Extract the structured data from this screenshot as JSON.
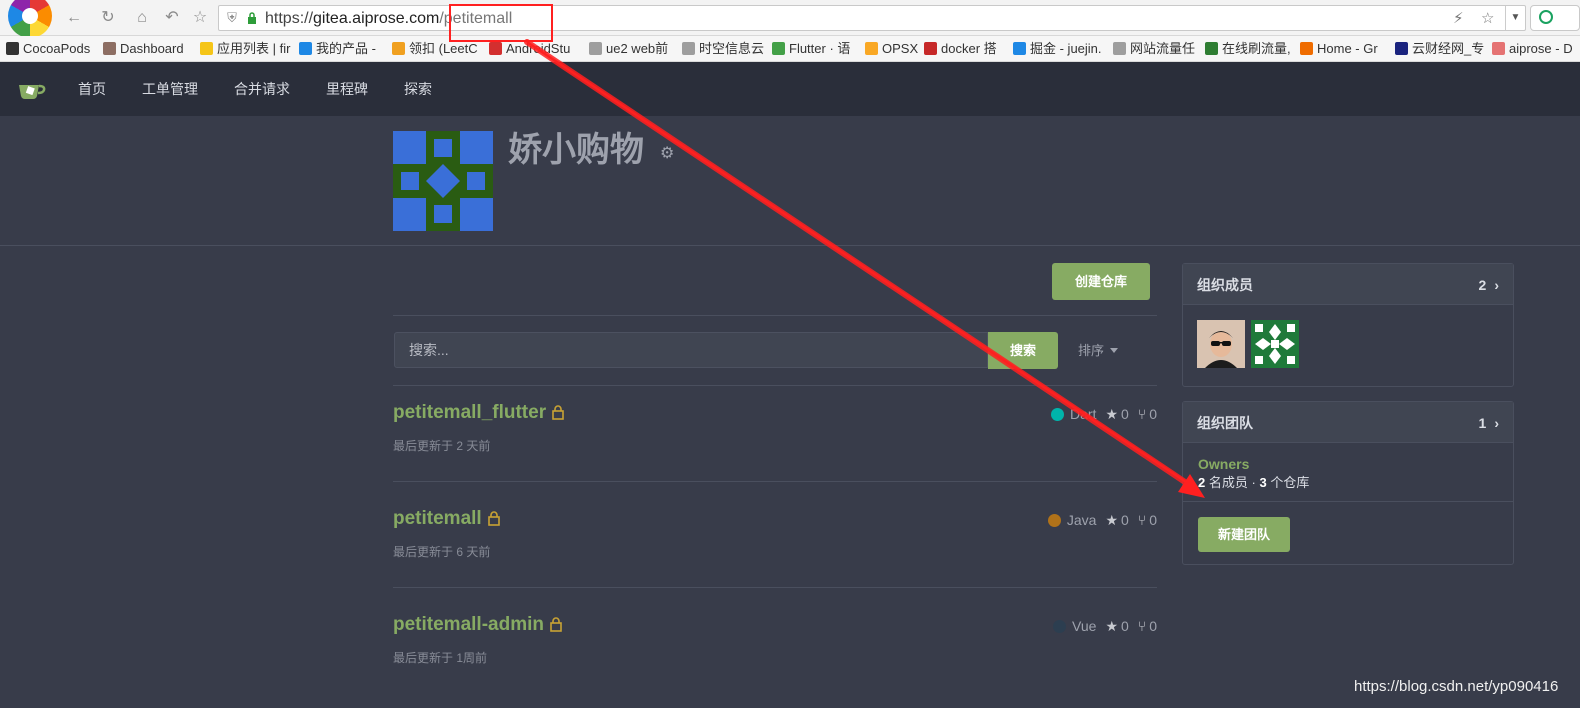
{
  "browser": {
    "url_prefix": "https://",
    "url_host": "gitea.aiprose.com",
    "url_path": "/petitemall",
    "bookmarks": [
      {
        "label": "CocoaPods",
        "color": "#333333"
      },
      {
        "label": "Dashboard",
        "color": "#8d6e63"
      },
      {
        "label": "应用列表 | fir",
        "color": "#f5c518"
      },
      {
        "label": "我的产品 -",
        "color": "#1e88e5"
      },
      {
        "label": "领扣 (LeetC",
        "color": "#f0a020"
      },
      {
        "label": "AndroidStu",
        "color": "#d32f2f"
      },
      {
        "label": "ue2 web前",
        "color": "#9e9e9e"
      },
      {
        "label": "时空信息云",
        "color": "#9e9e9e"
      },
      {
        "label": "Flutter · 语",
        "color": "#43a047"
      },
      {
        "label": "OPSX",
        "color": "#f9a825"
      },
      {
        "label": "docker 搭",
        "color": "#c62828"
      },
      {
        "label": "掘金 - juejin.",
        "color": "#1e88e5"
      },
      {
        "label": "网站流量任",
        "color": "#9e9e9e"
      },
      {
        "label": "在线刷流量,",
        "color": "#2e7d32"
      },
      {
        "label": "Home - Gr",
        "color": "#ef6c00"
      },
      {
        "label": "云财经网_专",
        "color": "#1a237e"
      },
      {
        "label": "aiprose - D",
        "color": "#e57373"
      }
    ]
  },
  "nav": {
    "items": [
      "首页",
      "工单管理",
      "合并请求",
      "里程碑",
      "探索"
    ]
  },
  "org": {
    "name": "娇小购物"
  },
  "main": {
    "create_repo_label": "创建仓库",
    "search_placeholder": "搜索...",
    "search_button": "搜索",
    "sort_label": "排序",
    "repos": [
      {
        "name": "petitemall_flutter",
        "updated": "最后更新于 2 天前",
        "language": "Dart",
        "lang_color": "#00b4ab",
        "stars": "0",
        "forks": "0"
      },
      {
        "name": "petitemall",
        "updated": "最后更新于 6 天前",
        "language": "Java",
        "lang_color": "#b07219",
        "stars": "0",
        "forks": "0"
      },
      {
        "name": "petitemall-admin",
        "updated": "最后更新于 1周前",
        "language": "Vue",
        "lang_color": "#2c3e50",
        "stars": "0",
        "forks": "0"
      }
    ]
  },
  "sidebar": {
    "members_title": "组织成员",
    "members_count": "2",
    "teams_title": "组织团队",
    "teams_count": "1",
    "team_name": "Owners",
    "team_members_count": "2",
    "team_members_label": "名成员",
    "team_sep": "·",
    "team_repos_count": "3",
    "team_repos_label": "个仓库",
    "new_team_label": "新建团队"
  },
  "watermark": "https://blog.csdn.net/yp090416",
  "colors": {
    "accent": "#87ab63",
    "background": "#383c4a",
    "navbar": "#2a2e3a",
    "annotation": "#ff2020"
  }
}
